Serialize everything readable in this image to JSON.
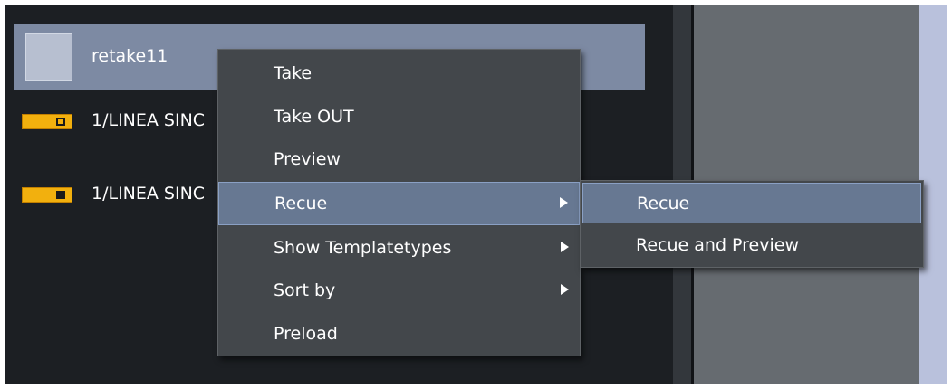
{
  "items": [
    {
      "label": "retake11"
    },
    {
      "label": "1/LINEA SINC"
    },
    {
      "label": "1/LINEA SINC"
    }
  ],
  "context_menu": {
    "items": [
      {
        "label": "Take"
      },
      {
        "label": "Take OUT"
      },
      {
        "label": "Preview"
      },
      {
        "label": "Recue"
      },
      {
        "label": "Show Templatetypes"
      },
      {
        "label": "Sort by"
      },
      {
        "label": "Preload"
      }
    ],
    "active_item": "Recue"
  },
  "submenu": {
    "items": [
      {
        "label": "Recue"
      },
      {
        "label": "Recue and Preview"
      }
    ],
    "active_item": "Recue"
  },
  "colors": {
    "list_background": "#1c1f23",
    "selection": "#7d8aa3",
    "menu_background": "#43474b",
    "menu_highlight": "#677892",
    "tag_yellow": "#f2b00e"
  },
  "icons": [
    "thumbnail",
    "template-tag-hollow",
    "template-tag-solid",
    "submenu-arrow"
  ]
}
